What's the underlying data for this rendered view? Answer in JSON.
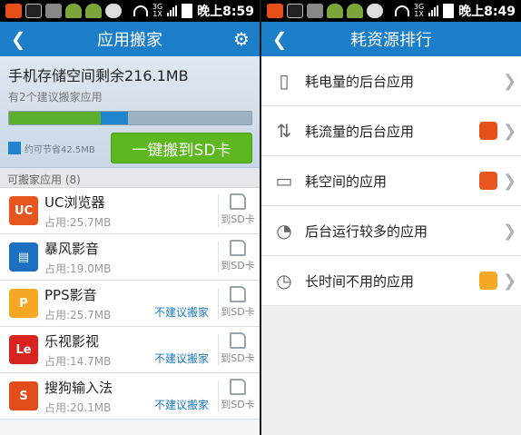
{
  "left": {
    "status": {
      "time": "晚上8:59",
      "net_top": "3G",
      "net_bottom": "1X"
    },
    "title": "应用搬家",
    "storage_headline": "手机存储空间剩余216.1MB",
    "suggest_text": "有2个建议搬家应用",
    "usage": {
      "used_fraction": 0.38,
      "movable_fraction": 0.11
    },
    "save_text": "约可节省42.5MB",
    "move_button": "一键搬到SD卡",
    "section_label": "可搬家应用 (8)",
    "to_sd_label": "到SD卡",
    "apps": [
      {
        "name": "UC浏览器",
        "size": "占用:25.7MB",
        "note": "",
        "icon_bg": "#e8561f",
        "icon_text": "UC"
      },
      {
        "name": "暴风影音",
        "size": "占用:19.0MB",
        "note": "",
        "icon_bg": "#1d6fbf",
        "icon_text": "▤"
      },
      {
        "name": "PPS影音",
        "size": "占用:25.7MB",
        "note": "不建议搬家",
        "icon_bg": "#f4a823",
        "icon_text": "P"
      },
      {
        "name": "乐视影视",
        "size": "占用:14.7MB",
        "note": "不建议搬家",
        "icon_bg": "#d9231f",
        "icon_text": "Le"
      },
      {
        "name": "搜狗输入法",
        "size": "占用:20.1MB",
        "note": "不建议搬家",
        "icon_bg": "#e24c1b",
        "icon_text": "S"
      }
    ]
  },
  "right": {
    "status": {
      "time": "晚上8:49",
      "net_top": "3G",
      "net_bottom": "1X"
    },
    "title": "耗资源排行",
    "items": [
      {
        "label": "耗电量的后台应用",
        "icon": "▯",
        "badge_color": ""
      },
      {
        "label": "耗流量的后台应用",
        "icon": "⇅",
        "badge_color": "#e8501a"
      },
      {
        "label": "耗空间的应用",
        "icon": "▭",
        "badge_color": "#e8561f"
      },
      {
        "label": "后台运行较多的应用",
        "icon": "◔",
        "badge_color": ""
      },
      {
        "label": "长时间不用的应用",
        "icon": "◷",
        "badge_color": "#f4a823"
      }
    ]
  }
}
